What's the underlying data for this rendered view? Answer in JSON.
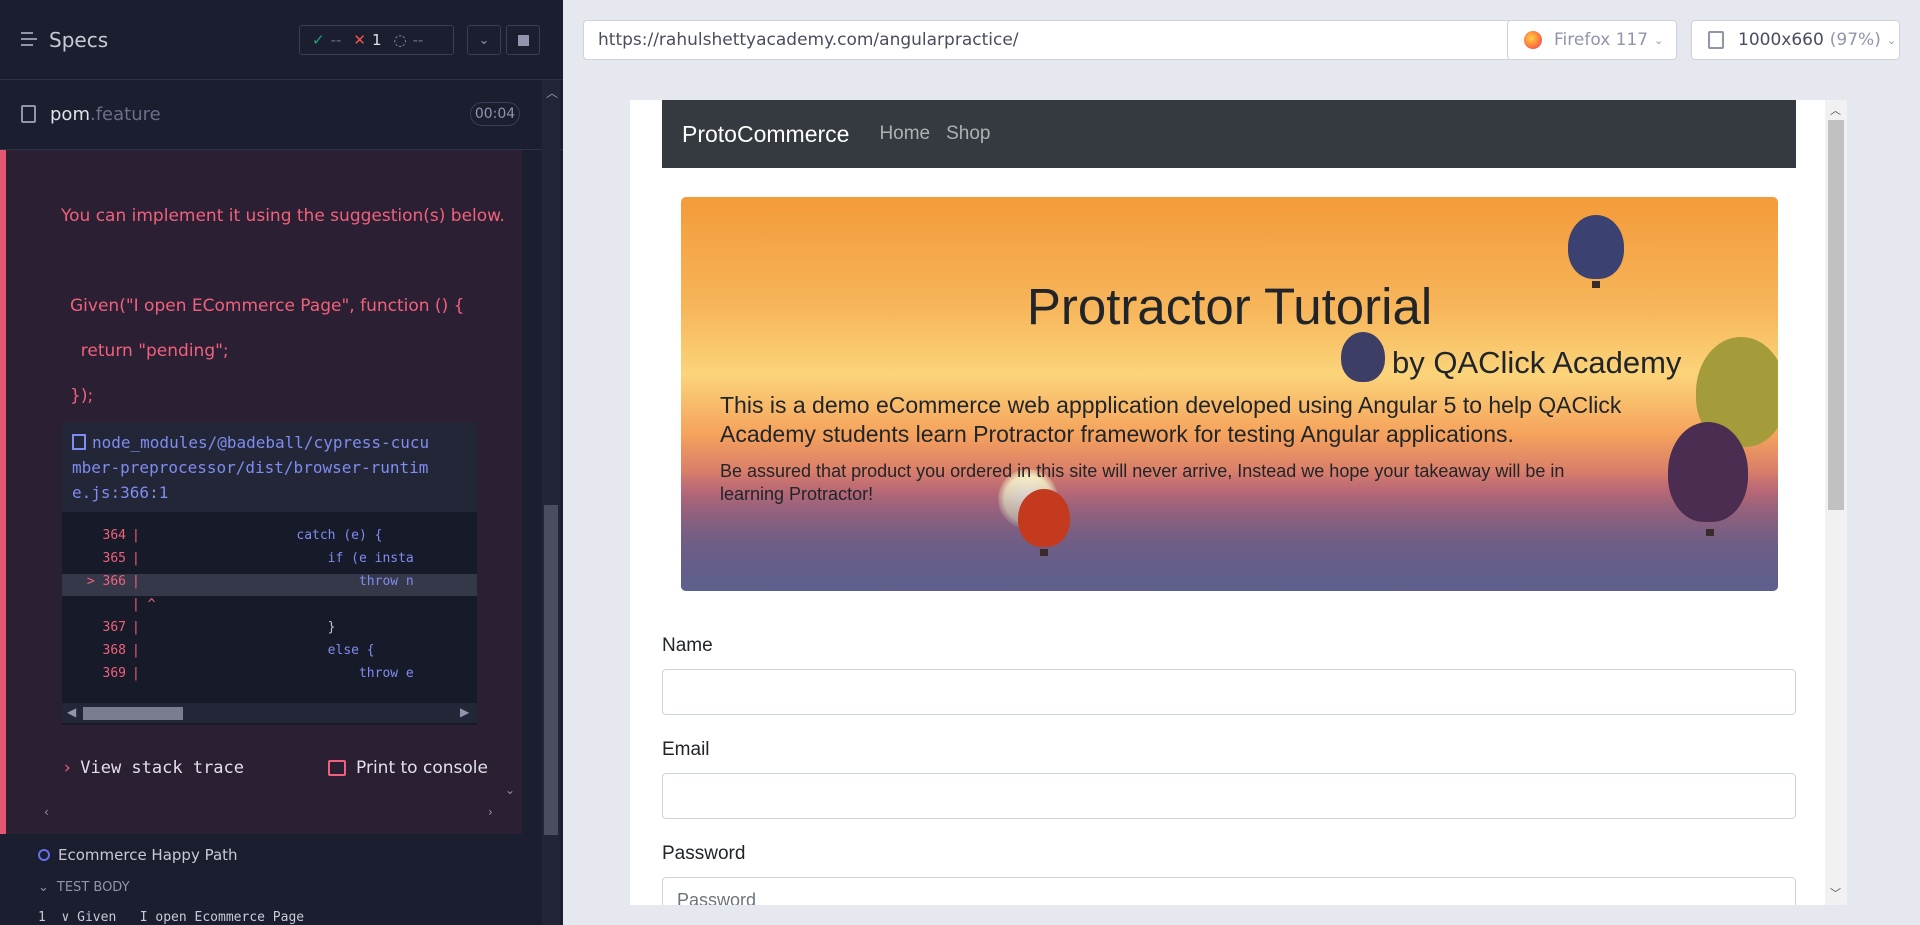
{
  "reporter": {
    "specs_label": "Specs",
    "stats": {
      "passed": "--",
      "failed": "1",
      "pending": "--"
    },
    "file": {
      "name": "pom",
      "ext": ".feature",
      "duration": "00:04"
    },
    "error": {
      "suggestion": "You can implement it using the suggestion(s) below.",
      "snippet_line1": "Given(\"I open ECommerce Page\", function () {",
      "snippet_line2": "  return \"pending\";",
      "snippet_line3": "});",
      "code_file": "node_modules/@badeball/cypress-cucumber-preprocessor/dist/browser-runtime.js:366:1",
      "code_file_lines": [
        "node_modules/@badeball/cypress-cucu",
        "mber-preprocessor/dist/browser-runtim",
        "e.js:366:1"
      ],
      "code_lines": [
        {
          "num": "364",
          "code": "                    catch (e) {"
        },
        {
          "num": "365",
          "code": "                        if (e insta"
        },
        {
          "num": "> 366",
          "code": "                            throw n"
        },
        {
          "num": "",
          "code": "^"
        },
        {
          "num": "367",
          "code": "                        }"
        },
        {
          "num": "368",
          "code": "                        else {"
        },
        {
          "num": "369",
          "code": "                            throw e"
        }
      ],
      "view_stack": "View stack trace",
      "print_console": "Print to console"
    },
    "test_title": "Ecommerce Happy Path",
    "test_body_label": "TEST BODY",
    "first_step": "1  ∨ Given   I open Ecommerce Page"
  },
  "toolbar": {
    "url": "https://rahulshettyacademy.com/angularpractice/",
    "browser": "Firefox 117",
    "viewport": "1000x660",
    "zoom": "(97%)"
  },
  "app": {
    "brand": "ProtoCommerce",
    "nav": [
      "Home",
      "Shop"
    ],
    "hero_title": "Protractor Tutorial",
    "hero_sub": "by QAClick Academy",
    "hero_lead": "This is a demo eCommerce web appplication developed using Angular 5 to help QAClick Academy students learn Protractor framework for testing Angular applications.",
    "hero_small": "Be assured that product you ordered in this site will never arrive, Instead we hope your takeaway will be in learning Protractor!",
    "fields": [
      {
        "label": "Name",
        "value": ""
      },
      {
        "label": "Email",
        "value": ""
      },
      {
        "label": "Password",
        "placeholder": "Password"
      }
    ]
  },
  "colors": {
    "error_accent": "#e45770",
    "navbar": "#343a40",
    "link": "#7f8cf0"
  }
}
